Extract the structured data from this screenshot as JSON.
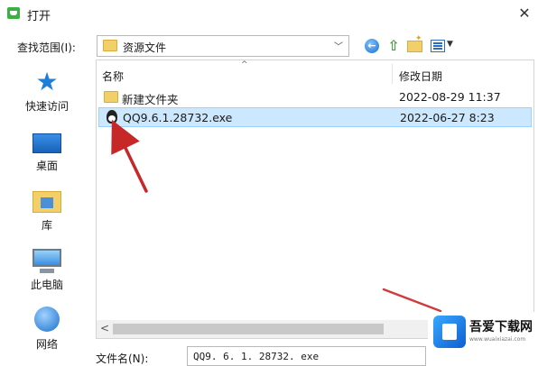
{
  "window": {
    "title": "打开",
    "close_glyph": "✕"
  },
  "location": {
    "label": "查找范围(I):",
    "value": "资源文件",
    "dropdown_glyph": "﹀"
  },
  "toolbar": {
    "back_icon": "back-arrow-icon",
    "up_icon": "up-folder-icon",
    "new_folder_icon": "new-folder-icon",
    "view_menu_icon": "view-menu-icon"
  },
  "sidebar": {
    "items": [
      {
        "label": "快速访问",
        "icon": "star-icon"
      },
      {
        "label": "桌面",
        "icon": "desktop-icon"
      },
      {
        "label": "库",
        "icon": "library-icon"
      },
      {
        "label": "此电脑",
        "icon": "computer-icon"
      },
      {
        "label": "网络",
        "icon": "network-icon"
      }
    ]
  },
  "filelist": {
    "columns": {
      "name": "名称",
      "date": "修改日期"
    },
    "sort_glyph": "^",
    "rows": [
      {
        "name": "新建文件夹",
        "date": "2022-08-29 11:37",
        "type": "folder",
        "selected": false
      },
      {
        "name": "QQ9.6.1.28732.exe",
        "date": "2022-06-27 8:23",
        "type": "exe",
        "selected": true
      }
    ],
    "scroll_left_glyph": "<"
  },
  "filename": {
    "label": "文件名(N):",
    "value": "QQ9. 6. 1. 28732. exe"
  },
  "watermark": {
    "title": "吾爱下载网",
    "subtitle": "www.wuaixiazai.com"
  },
  "colors": {
    "selection": "#cce8ff",
    "annotation_arrow": "#c62828",
    "accent": "#1e7fd8"
  }
}
